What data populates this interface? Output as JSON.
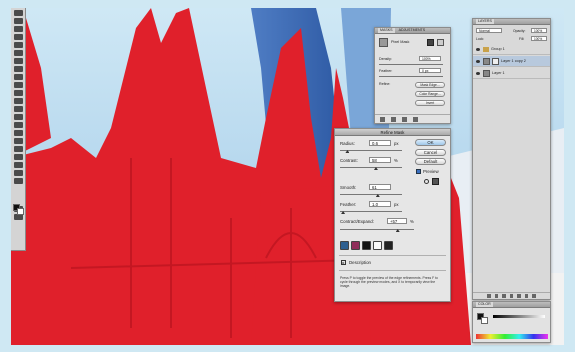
{
  "refine_mask": {
    "title": "Refine Mask",
    "radius": {
      "label": "Radius:",
      "value": "0.6",
      "unit": "px",
      "level": 0.12
    },
    "contrast": {
      "label": "Contrast:",
      "value": "58",
      "unit": "%",
      "level": 0.58
    },
    "smooth": {
      "label": "Smooth:",
      "value": "61",
      "level": 0.61
    },
    "feather": {
      "label": "Feather:",
      "value": "1.0",
      "unit": "px",
      "level": 0.05
    },
    "contract_expand": {
      "label": "Contract/Expand:",
      "value": "+57",
      "unit": "%",
      "level": 0.78
    },
    "buttons": {
      "ok": "OK",
      "cancel": "Cancel",
      "default": "Default"
    },
    "preview": {
      "label": "Preview",
      "checked": true
    },
    "description": {
      "label": "Description",
      "text": "Press P to toggle the preview of the edge refinements. Press F to cycle through the preview modes, and X to temporarily view the image."
    }
  },
  "masks_panel": {
    "tabs": [
      "MASKS",
      "ADJUSTMENTS"
    ],
    "mask_name": "Pixel Mask",
    "density": {
      "label": "Density:",
      "value": "100%"
    },
    "feather": {
      "label": "Feather:",
      "value": "0 px"
    },
    "refine_label": "Refine:",
    "buttons": [
      "Mask Edge...",
      "Color Range...",
      "Invert"
    ]
  },
  "layers_panel": {
    "tab": "LAYERS",
    "blend_mode": "Normal",
    "opacity": {
      "label": "Opacity:",
      "value": "100%"
    },
    "lock_label": "Lock:",
    "fill": {
      "label": "Fill:",
      "value": "100%"
    },
    "layers": [
      "Group 1",
      "Layer 1 copy 2",
      "Layer 1"
    ]
  },
  "color_panel": {
    "tab": "COLOR"
  },
  "colors": {
    "overlay": "#e0202b",
    "sky": "#cfe8f3",
    "panel_bg": "#e2e2e2"
  }
}
